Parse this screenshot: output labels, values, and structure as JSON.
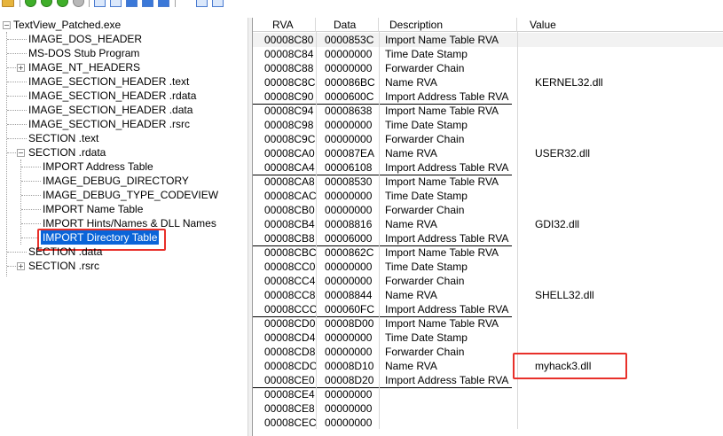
{
  "tree": {
    "root": "TextView_Patched.exe",
    "items": [
      {
        "label": "IMAGE_DOS_HEADER"
      },
      {
        "label": "MS-DOS Stub Program"
      },
      {
        "label": "IMAGE_NT_HEADERS"
      },
      {
        "label": "IMAGE_SECTION_HEADER .text"
      },
      {
        "label": "IMAGE_SECTION_HEADER .rdata"
      },
      {
        "label": "IMAGE_SECTION_HEADER .data"
      },
      {
        "label": "IMAGE_SECTION_HEADER .rsrc"
      },
      {
        "label": "SECTION .text"
      },
      {
        "label": "SECTION .rdata"
      },
      {
        "label": "IMPORT Address Table"
      },
      {
        "label": "IMAGE_DEBUG_DIRECTORY"
      },
      {
        "label": "IMAGE_DEBUG_TYPE_CODEVIEW"
      },
      {
        "label": "IMPORT Name Table"
      },
      {
        "label": "IMPORT Hints/Names & DLL Names"
      },
      {
        "label": "IMPORT Directory Table"
      },
      {
        "label": "SECTION .data"
      },
      {
        "label": "SECTION .rsrc"
      }
    ]
  },
  "table": {
    "columns": [
      "RVA",
      "Data",
      "Description",
      "Value"
    ],
    "rows": [
      {
        "rva": "00008C80",
        "data": "0000853C",
        "desc": "Import Name Table RVA",
        "value": ""
      },
      {
        "rva": "00008C84",
        "data": "00000000",
        "desc": "Time Date Stamp",
        "value": ""
      },
      {
        "rva": "00008C88",
        "data": "00000000",
        "desc": "Forwarder Chain",
        "value": ""
      },
      {
        "rva": "00008C8C",
        "data": "000086BC",
        "desc": "Name RVA",
        "value": "KERNEL32.dll"
      },
      {
        "rva": "00008C90",
        "data": "0000600C",
        "desc": "Import Address Table RVA",
        "value": ""
      },
      {
        "rva": "00008C94",
        "data": "00008638",
        "desc": "Import Name Table RVA",
        "value": ""
      },
      {
        "rva": "00008C98",
        "data": "00000000",
        "desc": "Time Date Stamp",
        "value": ""
      },
      {
        "rva": "00008C9C",
        "data": "00000000",
        "desc": "Forwarder Chain",
        "value": ""
      },
      {
        "rva": "00008CA0",
        "data": "000087EA",
        "desc": "Name RVA",
        "value": "USER32.dll"
      },
      {
        "rva": "00008CA4",
        "data": "00006108",
        "desc": "Import Address Table RVA",
        "value": ""
      },
      {
        "rva": "00008CA8",
        "data": "00008530",
        "desc": "Import Name Table RVA",
        "value": ""
      },
      {
        "rva": "00008CAC",
        "data": "00000000",
        "desc": "Time Date Stamp",
        "value": ""
      },
      {
        "rva": "00008CB0",
        "data": "00000000",
        "desc": "Forwarder Chain",
        "value": ""
      },
      {
        "rva": "00008CB4",
        "data": "00008816",
        "desc": "Name RVA",
        "value": "GDI32.dll"
      },
      {
        "rva": "00008CB8",
        "data": "00006000",
        "desc": "Import Address Table RVA",
        "value": ""
      },
      {
        "rva": "00008CBC",
        "data": "0000862C",
        "desc": "Import Name Table RVA",
        "value": ""
      },
      {
        "rva": "00008CC0",
        "data": "00000000",
        "desc": "Time Date Stamp",
        "value": ""
      },
      {
        "rva": "00008CC4",
        "data": "00000000",
        "desc": "Forwarder Chain",
        "value": ""
      },
      {
        "rva": "00008CC8",
        "data": "00008844",
        "desc": "Name RVA",
        "value": "SHELL32.dll"
      },
      {
        "rva": "00008CCC",
        "data": "000060FC",
        "desc": "Import Address Table RVA",
        "value": ""
      },
      {
        "rva": "00008CD0",
        "data": "00008D00",
        "desc": "Import Name Table RVA",
        "value": ""
      },
      {
        "rva": "00008CD4",
        "data": "00000000",
        "desc": "Time Date Stamp",
        "value": ""
      },
      {
        "rva": "00008CD8",
        "data": "00000000",
        "desc": "Forwarder Chain",
        "value": ""
      },
      {
        "rva": "00008CDC",
        "data": "00008D10",
        "desc": "Name RVA",
        "value": "myhack3.dll"
      },
      {
        "rva": "00008CE0",
        "data": "00008D20",
        "desc": "Import Address Table RVA",
        "value": ""
      },
      {
        "rva": "00008CE4",
        "data": "00000000",
        "desc": "",
        "value": ""
      },
      {
        "rva": "00008CE8",
        "data": "00000000",
        "desc": "",
        "value": ""
      },
      {
        "rva": "00008CEC",
        "data": "00000000",
        "desc": "",
        "value": ""
      }
    ]
  },
  "colors": {
    "selection": "#0a64d8",
    "highlight_box": "#e8302a"
  },
  "icons": [
    "open-folder-icon",
    "nav-green-icon",
    "nav-gray-icon",
    "view-toggle-icon",
    "view-grid-icon"
  ]
}
